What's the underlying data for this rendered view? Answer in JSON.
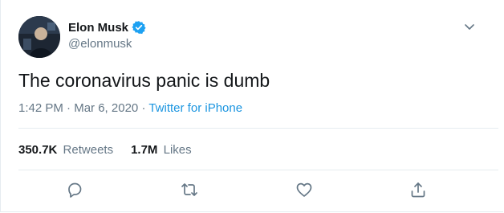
{
  "user": {
    "display_name": "Elon Musk",
    "handle": "@elonmusk",
    "verified": true,
    "avatar_icon": "user-avatar"
  },
  "tweet": {
    "text": "The coronavirus panic is dumb",
    "time": "1:42 PM",
    "date": "Mar 6, 2020",
    "separator": "·",
    "source": "Twitter for iPhone"
  },
  "stats": {
    "retweets_count": "350.7K",
    "retweets_label": "Retweets",
    "likes_count": "1.7M",
    "likes_label": "Likes"
  },
  "actions": [
    "reply-icon",
    "retweet-icon",
    "like-icon",
    "share-icon"
  ],
  "colors": {
    "text_primary": "#14171a",
    "text_secondary": "#657786",
    "link": "#1b95e0",
    "border": "#e6ecf0",
    "verified_badge": "#1da1f2"
  }
}
